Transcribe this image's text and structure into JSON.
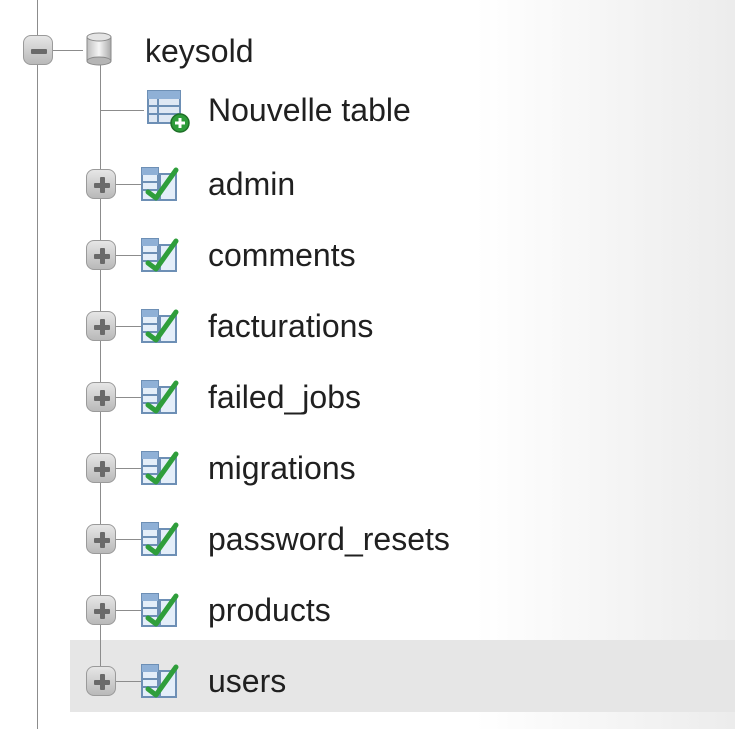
{
  "database": {
    "name": "keysold",
    "expanded": true
  },
  "new_table": {
    "label": "Nouvelle table"
  },
  "tables": [
    {
      "label": "admin"
    },
    {
      "label": "comments"
    },
    {
      "label": "facturations"
    },
    {
      "label": "failed_jobs"
    },
    {
      "label": "migrations"
    },
    {
      "label": "password_resets"
    },
    {
      "label": "products"
    },
    {
      "label": "users",
      "highlighted": true
    }
  ],
  "icons": {
    "collapse": "minus-icon",
    "expand": "plus-icon",
    "database": "database-icon",
    "new_table": "new-table-icon",
    "table": "table-icon"
  },
  "colors": {
    "highlight": "#e6e6e6",
    "text": "#202020",
    "line": "#8c8c8c"
  }
}
